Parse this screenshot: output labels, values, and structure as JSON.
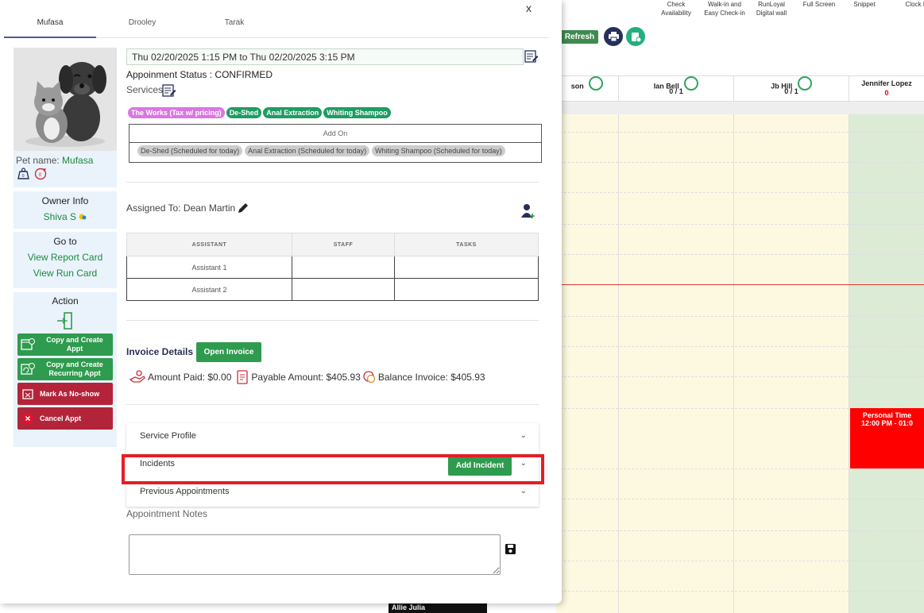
{
  "background": {
    "nav_items": [
      "Check\nAvailability",
      "Walk-in and\nEasy Check-in",
      "RunLoyal\nDigital wall",
      "Full Screen",
      "Snippet",
      "Clock In"
    ],
    "refresh_label": "Refresh",
    "staff": [
      {
        "name": "son",
        "count": ""
      },
      {
        "name": "Ian Bell",
        "count": "0 / 1"
      },
      {
        "name": "Jb Hill",
        "count": "0 / 1"
      },
      {
        "name": "Jennifer Lopez",
        "count": "0"
      }
    ],
    "personal_time": {
      "title": "Personal Time",
      "time": "12:00 PM - 01:0"
    },
    "allie_label": "Allie Julia"
  },
  "modal": {
    "tabs": [
      "Mufasa",
      "Drooley",
      "Tarak"
    ],
    "pet": {
      "label": "Pet name: ",
      "name": "Mufasa"
    },
    "owner": {
      "title": "Owner Info",
      "name": "Shiva S"
    },
    "goto": {
      "title": "Go to",
      "report_card": "View Report Card",
      "run_card": "View Run Card"
    },
    "action": {
      "title": "Action",
      "copy_create": "Copy and Create Appt",
      "copy_recurring": "Copy and Create Recurring Appt",
      "no_show": "Mark As No-show",
      "cancel": "Cancel Appt"
    },
    "date_range": "Thu 02/20/2025 1:15 PM to Thu 02/20/2025 3:15 PM",
    "status": "Appoinment Status : CONFIRMED",
    "services_label": "Services",
    "services": [
      {
        "label": "The Works (Tax w/ pricing)",
        "color": "#d877e0"
      },
      {
        "label": "De-Shed",
        "color": "#1f9c62"
      },
      {
        "label": "Anal Extraction",
        "color": "#1f9c62"
      },
      {
        "label": "Whiting Shampoo",
        "color": "#1f9c62"
      }
    ],
    "addon_title": "Add On",
    "addons": [
      "De-Shed (Scheduled for today)",
      "Anal Extraction (Scheduled for today)",
      "Whiting Shampoo (Scheduled for today)"
    ],
    "assigned": "Assigned To: Dean Martin",
    "table_headers": [
      "ASSISTANT",
      "STAFF",
      "TASKS"
    ],
    "table_rows": [
      [
        "Assistant 1",
        "",
        ""
      ],
      [
        "Assistant 2",
        "",
        ""
      ]
    ],
    "invoice_title": "Invoice Details",
    "open_invoice": "Open Invoice",
    "amount_paid": "Amount Paid: $0.00",
    "payable": "Payable Amount: $405.93",
    "balance": "Balance Invoice: $405.93",
    "accordion": [
      "Service Profile",
      "Incidents",
      "Previous Appointments"
    ],
    "add_incident": "Add Incident",
    "notes_label": "Appointment Notes",
    "close": "x"
  }
}
